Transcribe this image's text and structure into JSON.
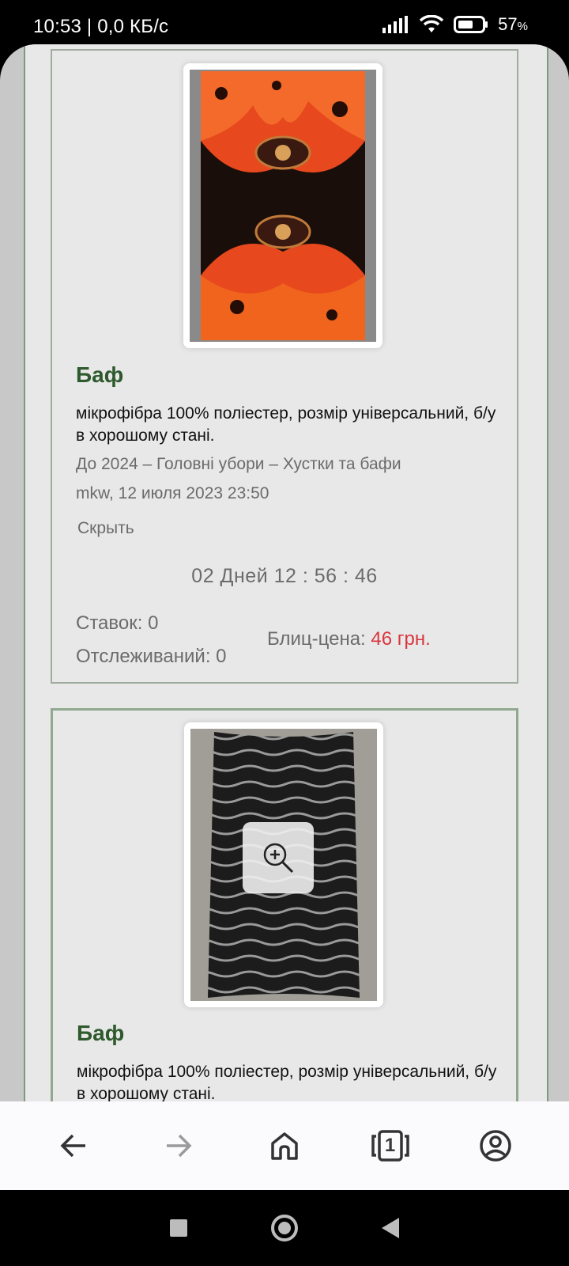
{
  "status_bar": {
    "time": "10:53 | 0,0 КБ/с",
    "battery": "57",
    "battery_unit": "%"
  },
  "listings": [
    {
      "title": "Баф",
      "description": "мікрофібра 100% поліестер, розмір універсальний, б/у в хорошому стані.",
      "category": "До 2024 – Головні убори – Хустки та бафи",
      "meta": "mkw, 12 июля 2023 23:50",
      "hide_label": "Скрыть",
      "timer": "02 Дней 12 : 56 : 46",
      "bids": "Ставок: 0",
      "watchers": "Отслеживаний: 0",
      "blitz_label": "Блиц-цена:",
      "blitz_price": "46 грн."
    },
    {
      "title": "Баф",
      "description": "мікрофібра 100% поліестер, розмір універсальний, б/у в хорошому стані."
    }
  ],
  "browser_nav": {
    "tabs_count": "1",
    "icons": [
      "back-arrow-icon",
      "forward-arrow-icon",
      "home-icon",
      "tabs-icon",
      "account-icon"
    ]
  },
  "colors": {
    "title_green": "#2e5a2e",
    "price_red": "#d9363e",
    "border_green": "#7e9a7e"
  }
}
